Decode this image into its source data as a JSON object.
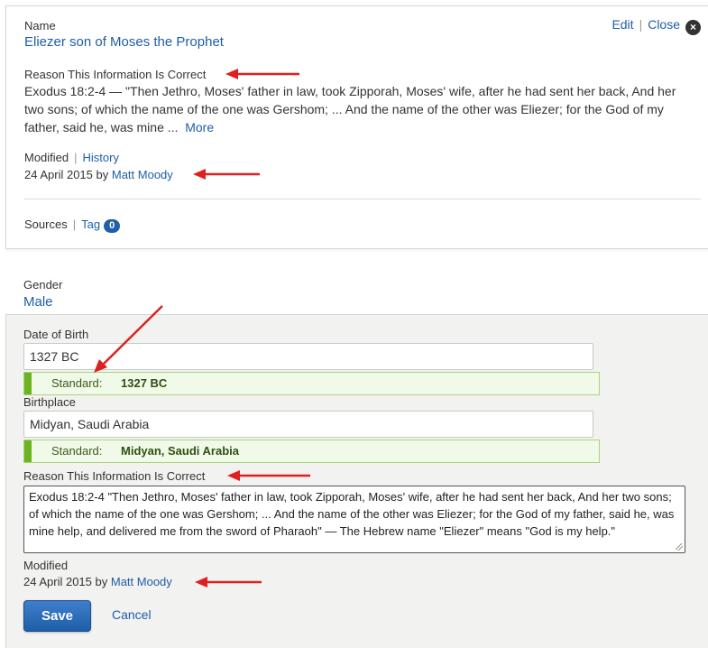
{
  "summary_card": {
    "name_label": "Name",
    "name_value": "Eliezer son of Moses the Prophet",
    "edit_label": "Edit",
    "close_label": "Close",
    "close_icon": "×",
    "reason_label": "Reason This Information Is Correct",
    "reason_text": "Exodus 18:2-4 — \"Then Jethro, Moses' father in law, took Zipporah, Moses' wife, after he had sent her back, And her two sons; of which the name of the one was Gershom; ... And the name of the other was Eliezer; for the God of my father, said he, was mine ...",
    "more_label": "More",
    "modified_label": "Modified",
    "history_label": "History",
    "modified_date": "24 April 2015 by",
    "modified_user": "Matt Moody",
    "sources_label": "Sources",
    "tag_label": "Tag",
    "tag_count": "0"
  },
  "gender": {
    "label": "Gender",
    "value": "Male"
  },
  "edit_form": {
    "dob_label": "Date of Birth",
    "dob_value": "1327 BC",
    "dob_standard_label": "Standard:",
    "dob_standard_value": "1327 BC",
    "birthplace_label": "Birthplace",
    "birthplace_value": "Midyan, Saudi Arabia",
    "birthplace_standard_label": "Standard:",
    "birthplace_standard_value": "Midyan, Saudi Arabia",
    "reason_label": "Reason This Information Is Correct",
    "reason_value": "Exodus 18:2-4 \"Then Jethro, Moses' father in law, took Zipporah, Moses' wife, after he had sent her back, And her two sons; of which the name of the one was Gershom; ... And the name of the other was Eliezer; for the God of my father, said he, was mine help, and delivered me from the sword of Pharaoh\" — The Hebrew name \"Eliezer\" means \"God is my help.\"",
    "modified_label": "Modified",
    "modified_date": "24 April 2015 by",
    "modified_user": "Matt Moody",
    "save_label": "Save",
    "cancel_label": "Cancel"
  },
  "colors": {
    "link": "#1f5ea8",
    "annotation_arrow": "#e02020",
    "standard_bar": "#6bb31f"
  }
}
